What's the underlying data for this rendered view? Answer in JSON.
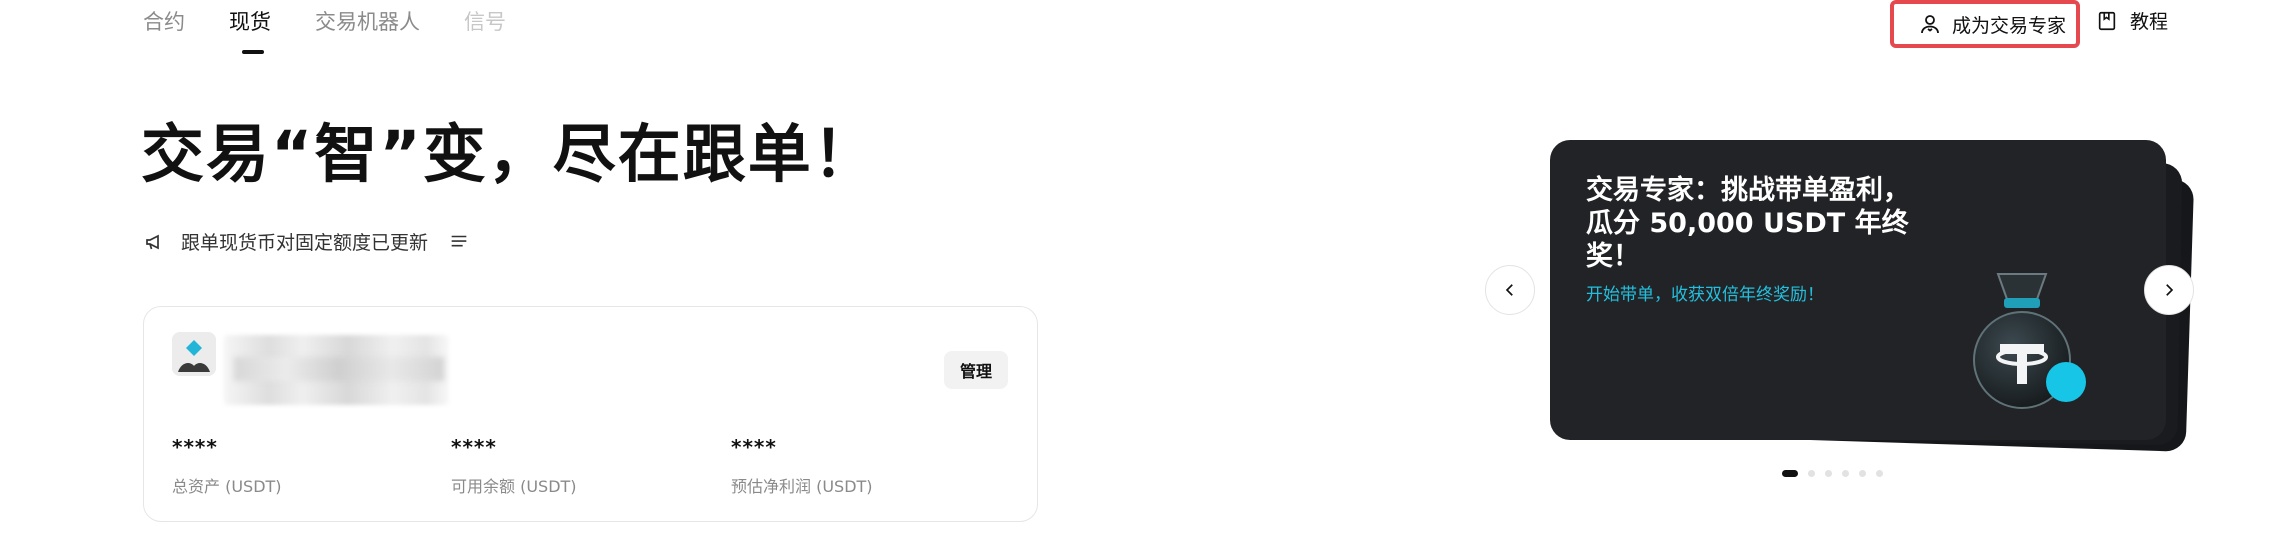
{
  "tabs": [
    {
      "label": "合约"
    },
    {
      "label": "现货"
    },
    {
      "label": "交易机器人"
    },
    {
      "label": "信号"
    }
  ],
  "header": {
    "become_expert": "成为交易专家",
    "tutorial": "教程"
  },
  "hero": {
    "headline": "交易“智”变，尽在跟单！",
    "notice": "跟单现货币对固定额度已更新"
  },
  "account": {
    "manage_label": "管理",
    "stats": [
      {
        "value": "****",
        "label": "总资产 (USDT)"
      },
      {
        "value": "****",
        "label": "可用余额 (USDT)"
      },
      {
        "value": "****",
        "label": "预估净利润 (USDT)"
      }
    ]
  },
  "banner": {
    "title": "交易专家：挑战带单盈利，瓜分 50,000 USDT 年终奖！",
    "subtitle": "开始带单，收获双倍年终奖励！",
    "dot_count": 6,
    "active_dot": 0
  },
  "colors": {
    "accent_cyan": "#22c0df",
    "highlight_red": "#e5484d",
    "banner_bg": "#222326"
  }
}
